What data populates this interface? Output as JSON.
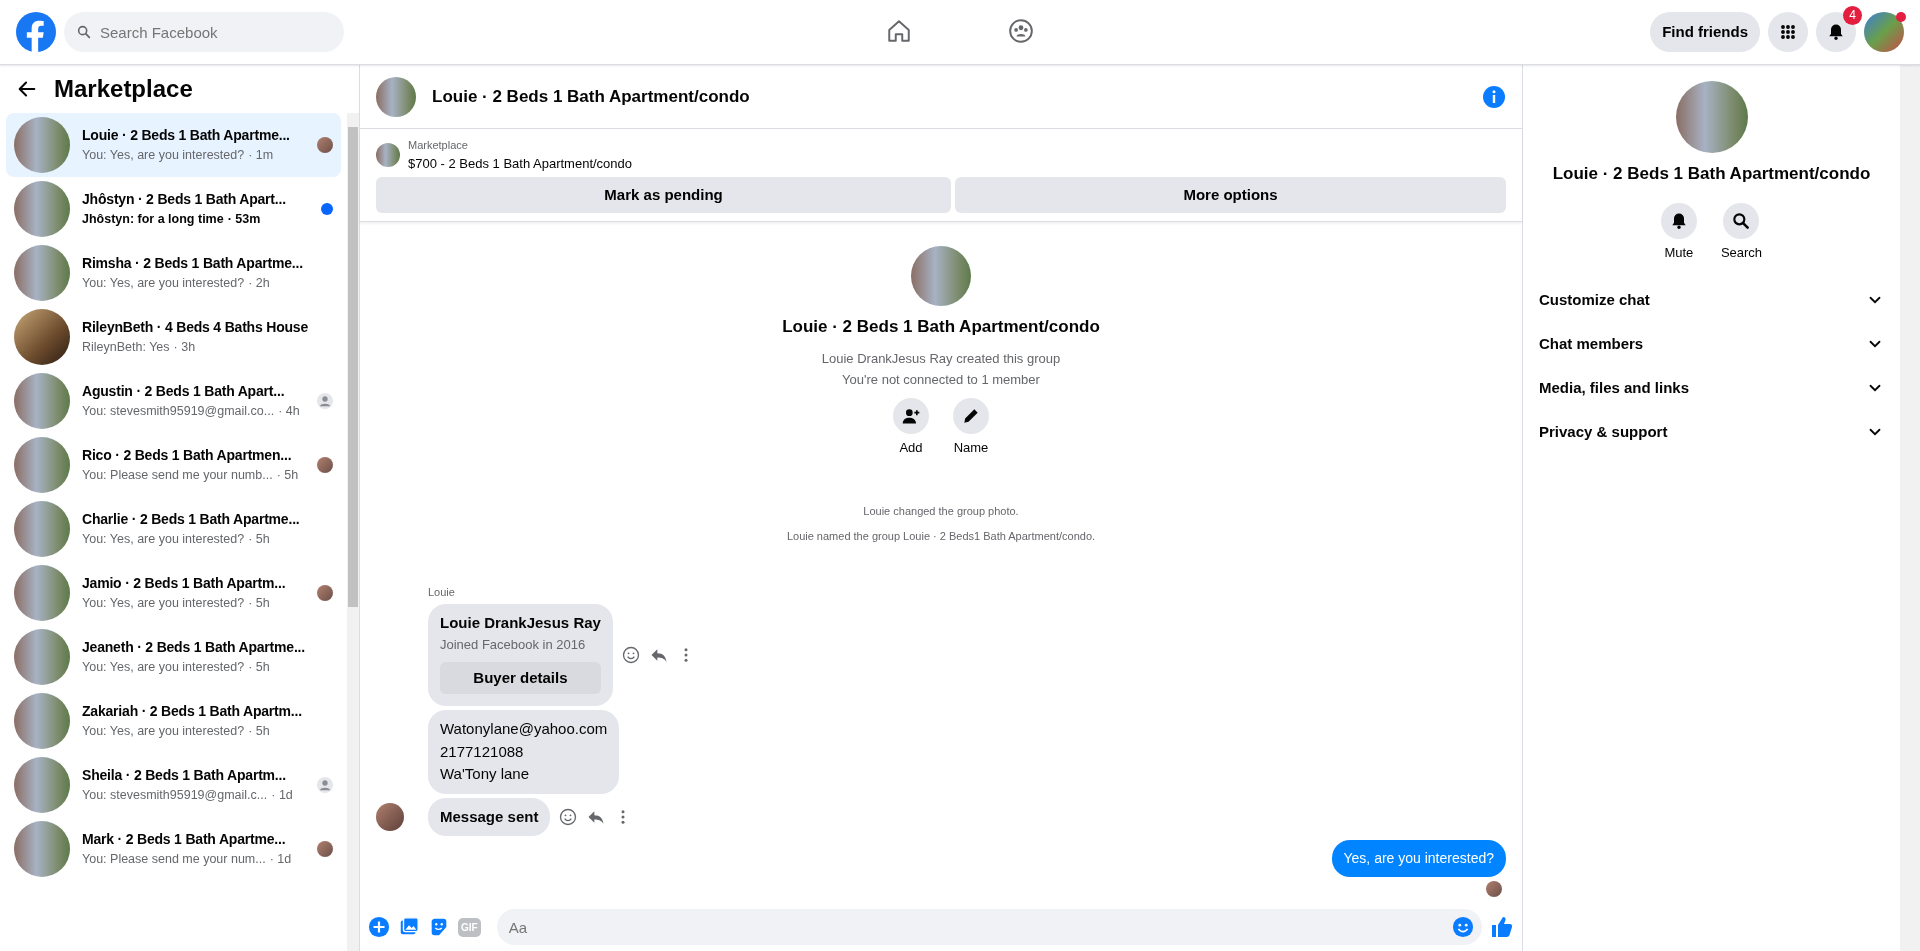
{
  "topbar": {
    "search": {
      "placeholder": "Search Facebook"
    },
    "nav": [
      {
        "kind": "home",
        "selected": false
      },
      {
        "kind": "groups",
        "selected": false
      }
    ],
    "find_friends": "Find friends",
    "notifications_badge": "4"
  },
  "sidebar": {
    "title": "Marketplace",
    "conversations": [
      {
        "photo": {
          "kind": "building"
        },
        "title": "Louie · 2 Beds 1 Bath Apartme...",
        "preview": "You: Yes, are you interested?",
        "time": "· 1m",
        "selected": true,
        "unread": false,
        "seen": {
          "kind": "avatar"
        }
      },
      {
        "photo": {
          "kind": "building"
        },
        "title": "Jhôstyn · 2 Beds 1 Bath Apart...",
        "preview": "Jhôstyn: for a long time",
        "time": "· 53m",
        "selected": false,
        "unread": true,
        "seen": {
          "kind": "none"
        }
      },
      {
        "photo": {
          "kind": "building"
        },
        "title": "Rimsha · 2 Beds 1 Bath Apartme...",
        "preview": "You: Yes, are you interested?",
        "time": "· 2h",
        "selected": false,
        "unread": false,
        "seen": {
          "kind": "none"
        }
      },
      {
        "photo": {
          "kind": "house"
        },
        "title": "RileynBeth · 4 Beds 4 Baths House",
        "preview": "RileynBeth: Yes",
        "time": "· 3h",
        "selected": false,
        "unread": false,
        "seen": {
          "kind": "none"
        }
      },
      {
        "photo": {
          "kind": "building"
        },
        "title": "Agustin · 2 Beds 1 Bath Apart...",
        "preview": "You: stevesmith95919@gmail.co...",
        "time": "· 4h",
        "selected": false,
        "unread": false,
        "seen": {
          "kind": "silhouette"
        }
      },
      {
        "photo": {
          "kind": "building"
        },
        "title": "Rico · 2 Beds 1 Bath Apartmen...",
        "preview": "You: Please send me your numb...",
        "time": "· 5h",
        "selected": false,
        "unread": false,
        "seen": {
          "kind": "avatar"
        }
      },
      {
        "photo": {
          "kind": "building"
        },
        "title": "Charlie · 2 Beds 1 Bath Apartme...",
        "preview": "You: Yes, are you interested?",
        "time": "· 5h",
        "selected": false,
        "unread": false,
        "seen": {
          "kind": "none"
        }
      },
      {
        "photo": {
          "kind": "building"
        },
        "title": "Jamio · 2 Beds 1 Bath Apartm...",
        "preview": "You: Yes, are you interested?",
        "time": "· 5h",
        "selected": false,
        "unread": false,
        "seen": {
          "kind": "avatar"
        }
      },
      {
        "photo": {
          "kind": "building"
        },
        "title": "Jeaneth · 2 Beds 1 Bath Apartme...",
        "preview": "You: Yes, are you interested?",
        "time": "· 5h",
        "selected": false,
        "unread": false,
        "seen": {
          "kind": "none"
        }
      },
      {
        "photo": {
          "kind": "building"
        },
        "title": "Zakariah · 2 Beds 1 Bath Apartm...",
        "preview": "You: Yes, are you interested?",
        "time": "· 5h",
        "selected": false,
        "unread": false,
        "seen": {
          "kind": "none"
        }
      },
      {
        "photo": {
          "kind": "building"
        },
        "title": "Sheila · 2 Beds 1 Bath Apartm...",
        "preview": "You: stevesmith95919@gmail.c...",
        "time": "· 1d",
        "selected": false,
        "unread": false,
        "seen": {
          "kind": "silhouette"
        }
      },
      {
        "photo": {
          "kind": "building"
        },
        "title": "Mark · 2 Beds 1 Bath Apartme...",
        "preview": "You: Please send me your num...",
        "time": "· 1d",
        "selected": false,
        "unread": false,
        "seen": {
          "kind": "avatar"
        }
      }
    ]
  },
  "chat": {
    "title": "Louie · 2 Beds 1 Bath Apartment/condo",
    "listing": {
      "label": "Marketplace",
      "price_line": "$700 - 2 Beds 1 Bath Apartment/condo",
      "buttons": [
        "Mark as pending",
        "More options"
      ]
    },
    "intro": {
      "title": "Louie · 2 Beds 1 Bath Apartment/condo",
      "lines": [
        "Louie DrankJesus Ray created this group",
        "You're not connected to 1 member"
      ],
      "actions": [
        {
          "kind": "add",
          "label": "Add"
        },
        {
          "kind": "name",
          "label": "Name"
        }
      ]
    },
    "events": [
      "Louie changed the group photo.",
      "Louie named the group Louie · 2 Beds1 Bath Apartment/condo."
    ],
    "messages": [
      {
        "kind": "buyer-card",
        "sender": "Louie",
        "name": "Louie DrankJesus Ray",
        "joined": "Joined Facebook in 2016",
        "button": "Buyer details",
        "actions": true,
        "avatar": false
      },
      {
        "kind": "text",
        "lines": [
          "Watonylane@yahoo.com",
          "2177121088",
          "Wa'Tony lane"
        ],
        "actions": false,
        "avatar": false
      },
      {
        "kind": "text",
        "lines": [
          "Message sent"
        ],
        "bold": true,
        "actions": true,
        "avatar": true
      },
      {
        "kind": "outgoing",
        "lines": [
          "Yes, are you interested?"
        ],
        "seen": true
      }
    ],
    "composer": {
      "gif": "GIF",
      "placeholder": "Aa"
    }
  },
  "details": {
    "title": "Louie · 2 Beds 1 Bath Apartment/condo",
    "actions": [
      {
        "kind": "mute",
        "label": "Mute"
      },
      {
        "kind": "search",
        "label": "Search"
      }
    ],
    "sections": [
      {
        "label": "Customize chat",
        "expanded": false
      },
      {
        "label": "Chat members",
        "expanded": false
      },
      {
        "label": "Media, files and links",
        "expanded": false
      },
      {
        "label": "Privacy & support",
        "expanded": false
      }
    ]
  }
}
